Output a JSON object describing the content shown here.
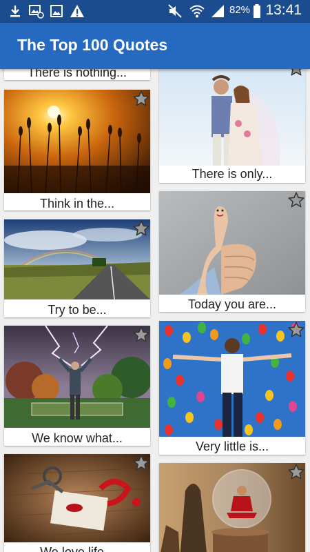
{
  "status_bar": {
    "icons": [
      "download-icon",
      "image-at-icon",
      "gallery-icon",
      "warning-icon",
      "mute-icon",
      "wifi-icon",
      "signal-icon",
      "battery-icon"
    ],
    "battery": "82%",
    "time": "13:41"
  },
  "appbar": {
    "title": "The Top 100 Quotes"
  },
  "quotes": {
    "q0": "There is nothing...",
    "q1": "Think in the...",
    "q2": "Try to be...",
    "q3": "We know what...",
    "q4": "We love life...",
    "q5": "There is only...",
    "q6": "Today you are...",
    "q7": "Very little is..."
  },
  "colors": {
    "status_bar": "#1a4c8f",
    "app_bar": "#2569c0",
    "background": "#efefef"
  }
}
